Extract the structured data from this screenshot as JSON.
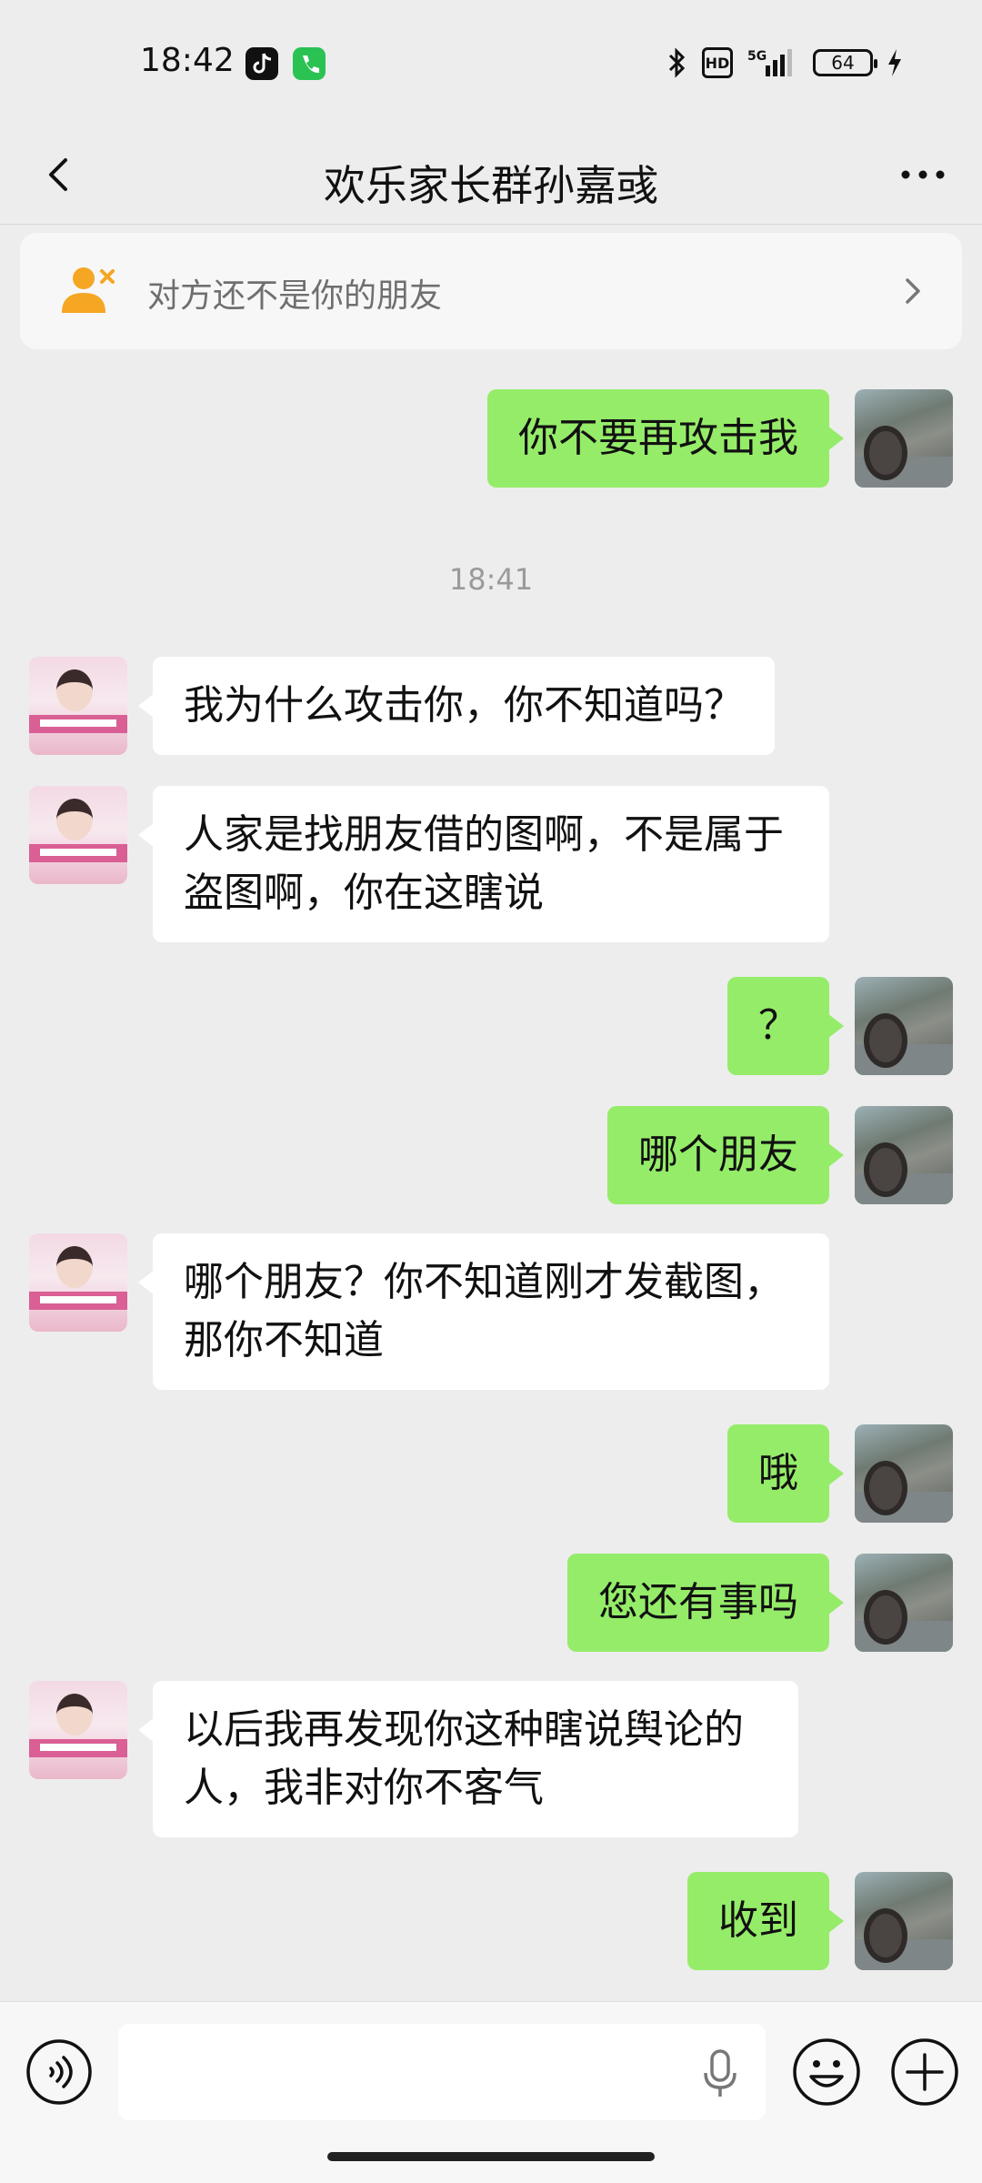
{
  "status_bar": {
    "time": "18:42",
    "battery": "64",
    "hd": "HD",
    "network": "5G"
  },
  "header": {
    "title": "欢乐家长群孙嘉彧"
  },
  "notice": {
    "text": "对方还不是你的朋友"
  },
  "timestamp": "18:41",
  "messages": [
    {
      "sender": "me",
      "text": "你不要再攻击我"
    },
    {
      "sender": "other",
      "text": "我为什么攻击你，你不知道吗？"
    },
    {
      "sender": "other",
      "text": "人家是找朋友借的图啊，不是属于盗图啊，你在这瞎说"
    },
    {
      "sender": "me",
      "text": "？"
    },
    {
      "sender": "me",
      "text": "哪个朋友"
    },
    {
      "sender": "other",
      "text": "哪个朋友？你不知道刚才发截图，那你不知道"
    },
    {
      "sender": "me",
      "text": "哦"
    },
    {
      "sender": "me",
      "text": "您还有事吗"
    },
    {
      "sender": "other",
      "text": "以后我再发现你这种瞎说舆论的人，我非对你不客气"
    },
    {
      "sender": "me",
      "text": "收到"
    }
  ],
  "input": {
    "value": "",
    "placeholder": ""
  },
  "icons": [
    "back-icon",
    "more-icon",
    "add-friend-warning-icon",
    "chevron-right-icon",
    "voice-icon",
    "mic-icon",
    "emoji-icon",
    "plus-icon"
  ],
  "colors": {
    "background": "#ededed",
    "my_bubble": "#95ec69",
    "other_bubble": "#ffffff",
    "warning_icon": "#f5a623"
  }
}
